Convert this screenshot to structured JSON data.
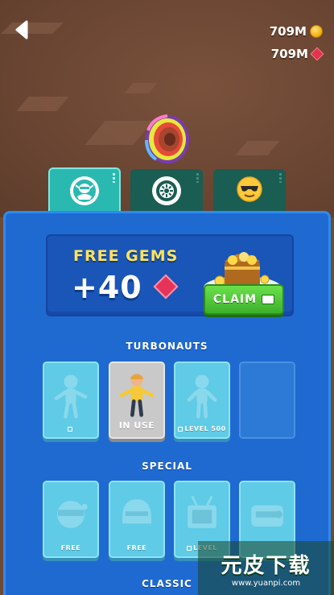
{
  "header": {
    "coins": "709M",
    "gems": "709M"
  },
  "tabs": [
    {
      "name": "characters",
      "icon": "turbonaut-icon",
      "active": true
    },
    {
      "name": "wheels",
      "icon": "tire-icon",
      "active": false
    },
    {
      "name": "emotes",
      "icon": "sunglasses-emoji-icon",
      "active": false
    }
  ],
  "promo": {
    "title": "FREE GEMS",
    "amount": "+40",
    "claim_label": "CLAIM"
  },
  "sections": {
    "turbonauts": "TURBONAUTS",
    "special": "SPECIAL",
    "classic": "CLASSIC"
  },
  "turbonauts": [
    {
      "caption": "",
      "locked": true,
      "state": "locked"
    },
    {
      "caption": "IN USE",
      "locked": false,
      "state": "selected"
    },
    {
      "caption": "LEVEL 500",
      "locked": true,
      "state": "locked"
    },
    {
      "caption": "",
      "locked": false,
      "state": "empty"
    }
  ],
  "special": [
    {
      "caption": "FREE",
      "icon": "ninja-head-icon"
    },
    {
      "caption": "FREE",
      "icon": "helmet-icon"
    },
    {
      "caption": "LEVEL",
      "icon": "tv-head-icon",
      "locked": true
    },
    {
      "caption": "",
      "icon": "robot-head-icon"
    }
  ],
  "watermark": {
    "big": "元皮下载",
    "small": "www.yuanpi.com"
  },
  "colors": {
    "panel": "#1f6ad1",
    "tab_active": "#2ab9b0",
    "tab_inactive": "#1a5d52",
    "claim": "#3db02c",
    "promo_title": "#ffe35a"
  }
}
